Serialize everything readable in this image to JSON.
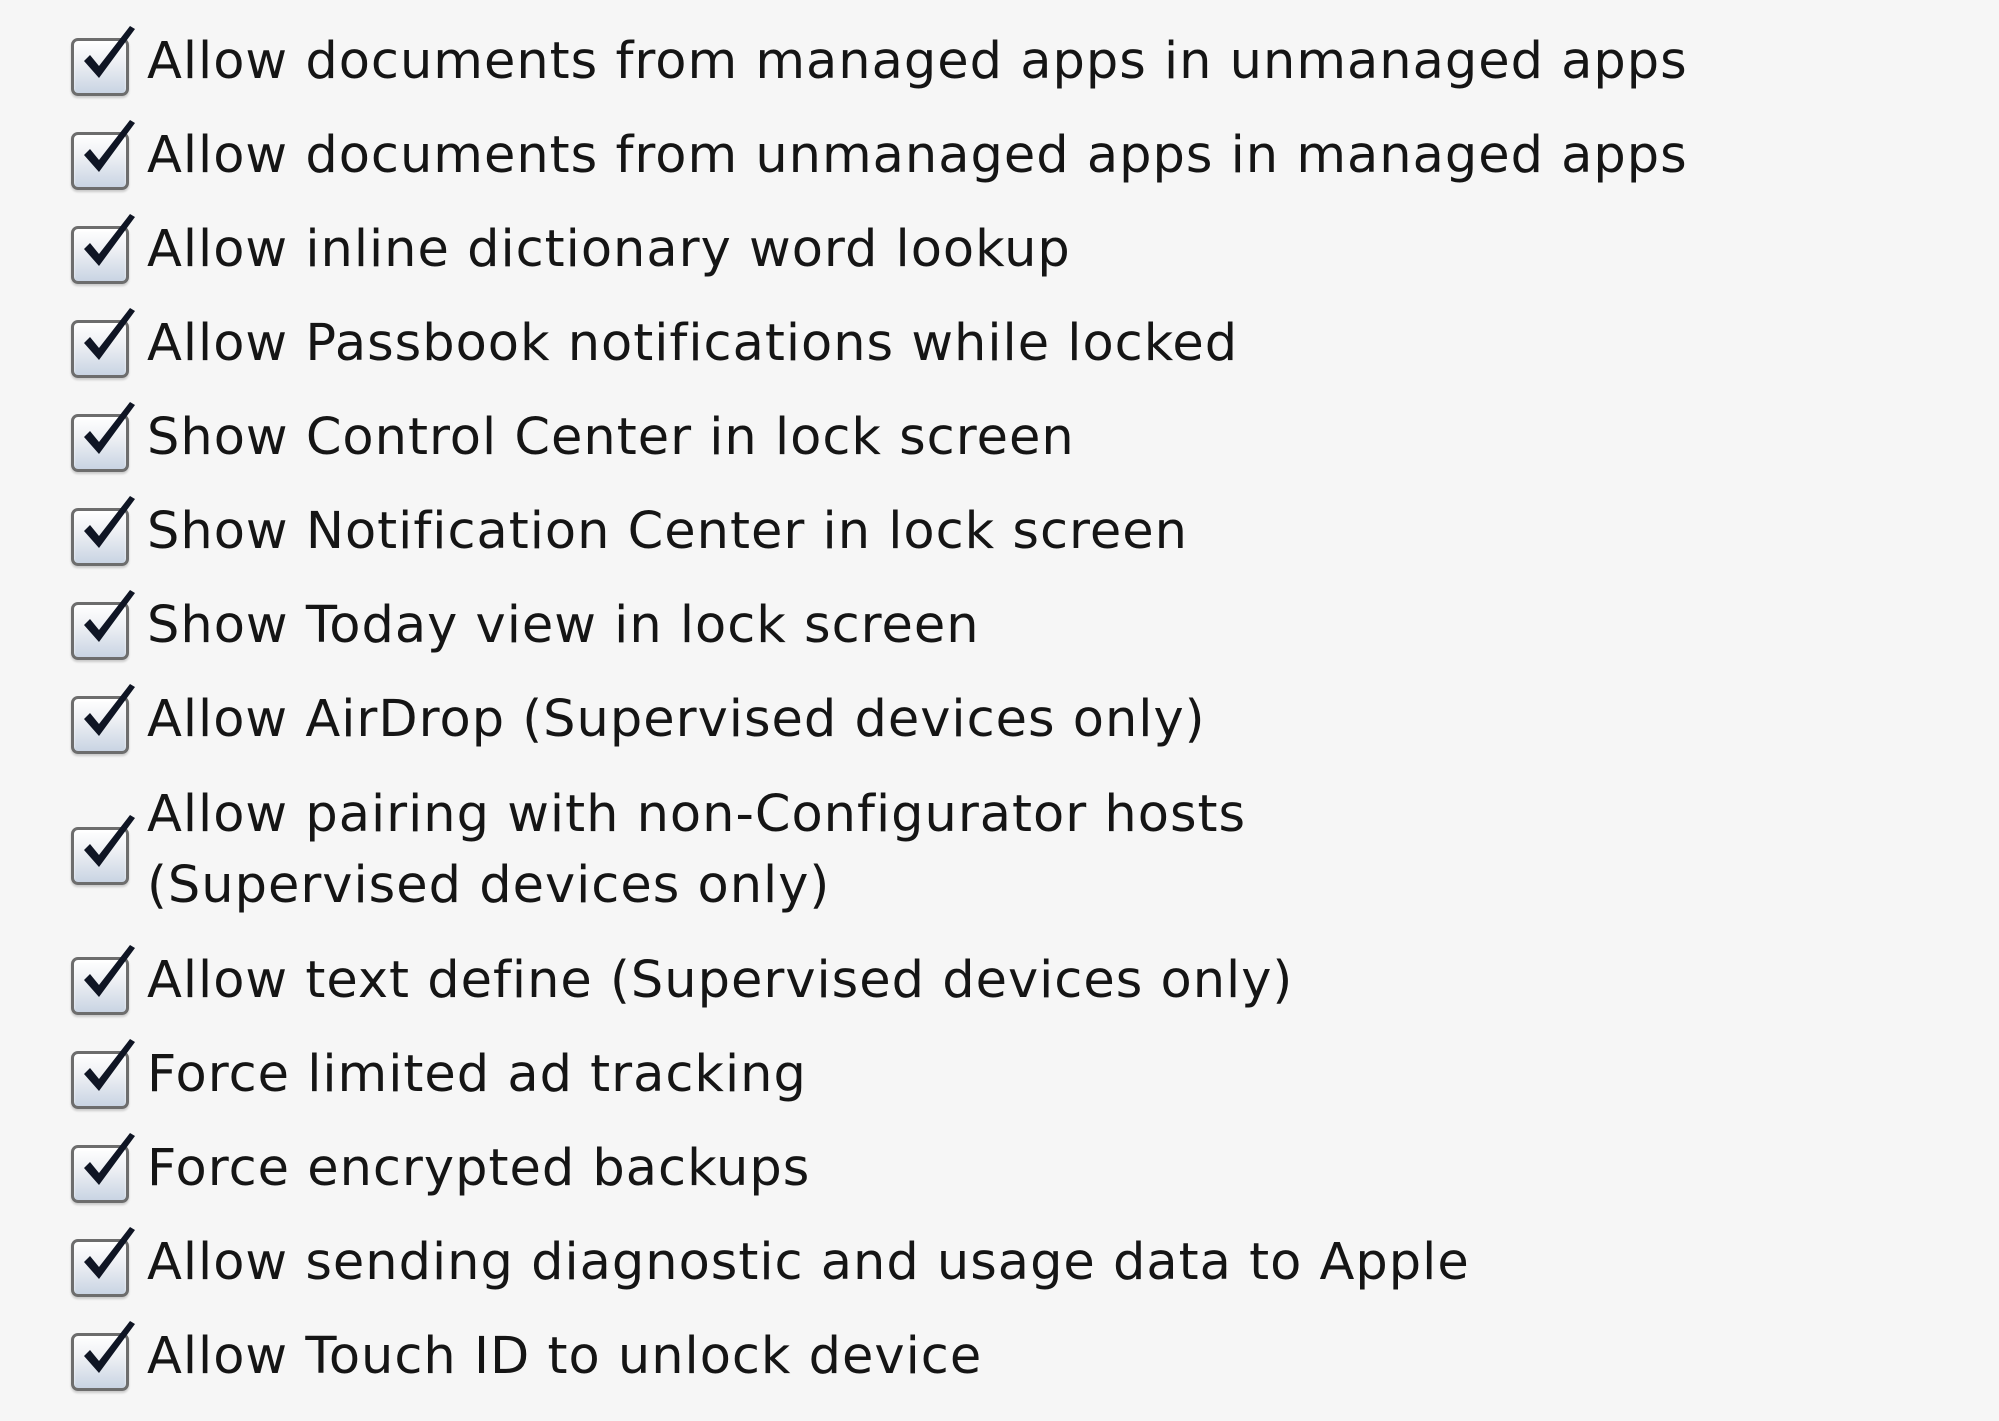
{
  "restrictions": {
    "options": [
      {
        "label": "Allow documents from managed apps in unmanaged apps",
        "checked": true
      },
      {
        "label": "Allow documents from unmanaged apps in managed apps",
        "checked": true
      },
      {
        "label": "Allow inline dictionary word lookup",
        "checked": true
      },
      {
        "label": "Allow Passbook notifications while locked",
        "checked": true
      },
      {
        "label": "Show Control Center in lock screen",
        "checked": true
      },
      {
        "label": "Show Notification Center in lock screen",
        "checked": true
      },
      {
        "label": "Show Today view in lock screen",
        "checked": true
      },
      {
        "label": "Allow AirDrop (Supervised devices only)",
        "checked": true
      },
      {
        "label_line1": "Allow pairing with non-Configurator hosts",
        "label_line2": "(Supervised devices only)",
        "checked": true
      },
      {
        "label": "Allow text define (Supervised devices only)",
        "checked": true
      },
      {
        "label": "Force limited ad tracking",
        "checked": true
      },
      {
        "label": "Force encrypted backups",
        "checked": true
      },
      {
        "label": "Allow sending diagnostic and usage data to Apple",
        "checked": true
      },
      {
        "label": "Allow Touch ID to unlock device",
        "checked": true
      }
    ]
  },
  "icons": {
    "checkbox": "checkmark-icon"
  },
  "colors": {
    "background": "#f6f6f6",
    "checkmark": "#0f1524",
    "checkbox_border": "#6d6d6d"
  }
}
